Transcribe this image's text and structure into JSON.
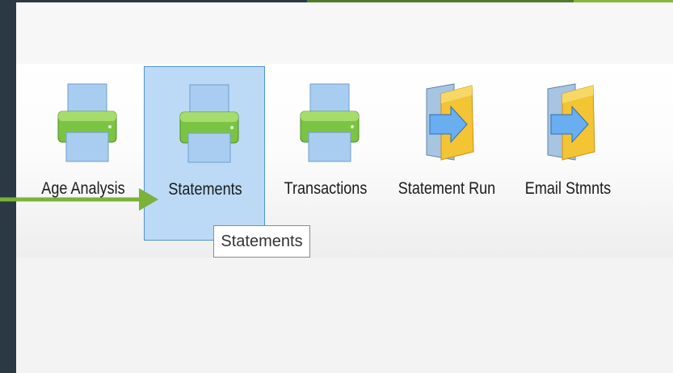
{
  "toolbar": {
    "items": [
      {
        "label": "Age Analysis",
        "icon": "printer-icon"
      },
      {
        "label": "Statements",
        "icon": "printer-icon",
        "selected": true
      },
      {
        "label": "Transactions",
        "icon": "printer-icon"
      },
      {
        "label": "Statement Run",
        "icon": "folder-arrow-icon"
      },
      {
        "label": "Email Stmnts",
        "icon": "folder-arrow-icon"
      }
    ]
  },
  "tooltip": {
    "text": "Statements"
  },
  "colors": {
    "selection": "#bcdaf5",
    "selection_border": "#4f95d1",
    "pointer_arrow": "#7ab23a",
    "printer_green": "#6fbf3f",
    "folder_yellow": "#f3c433"
  }
}
